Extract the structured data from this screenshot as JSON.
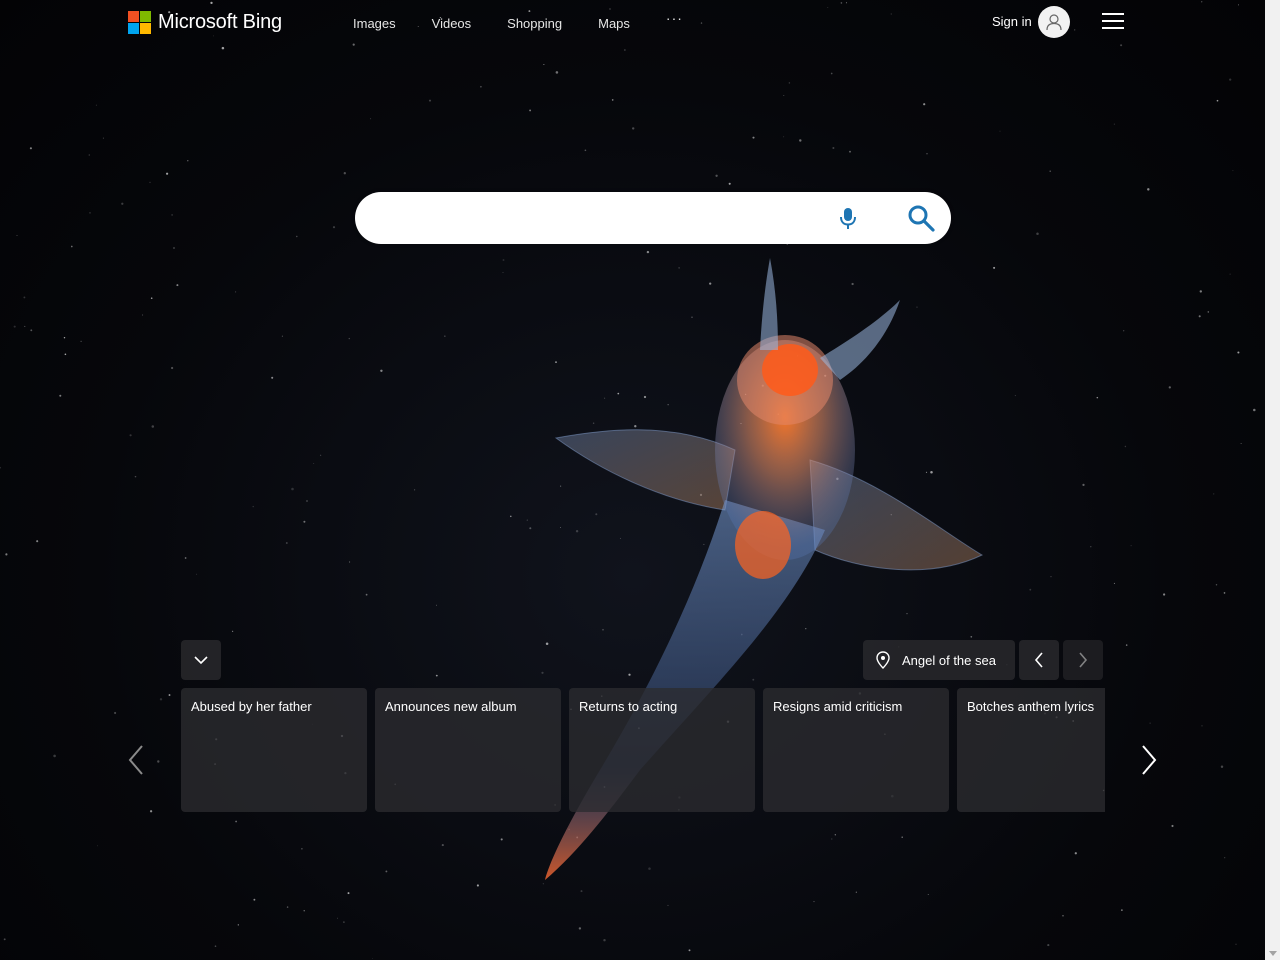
{
  "brand": {
    "name": "Microsoft Bing",
    "logo_colors": [
      "#f25022",
      "#7fba00",
      "#00a4ef",
      "#ffb900"
    ]
  },
  "nav": {
    "items": [
      "Images",
      "Videos",
      "Shopping",
      "Maps"
    ],
    "more_label": "···"
  },
  "account": {
    "signin_label": "Sign in"
  },
  "search": {
    "value": "",
    "icon_color": "#1e75b3"
  },
  "background": {
    "location_label": "Angel of the sea"
  },
  "news_cards": [
    {
      "title": "Abused by her father"
    },
    {
      "title": "Announces new album"
    },
    {
      "title": "Returns to acting"
    },
    {
      "title": "Resigns amid criticism"
    },
    {
      "title": "Botches anthem lyrics"
    }
  ]
}
